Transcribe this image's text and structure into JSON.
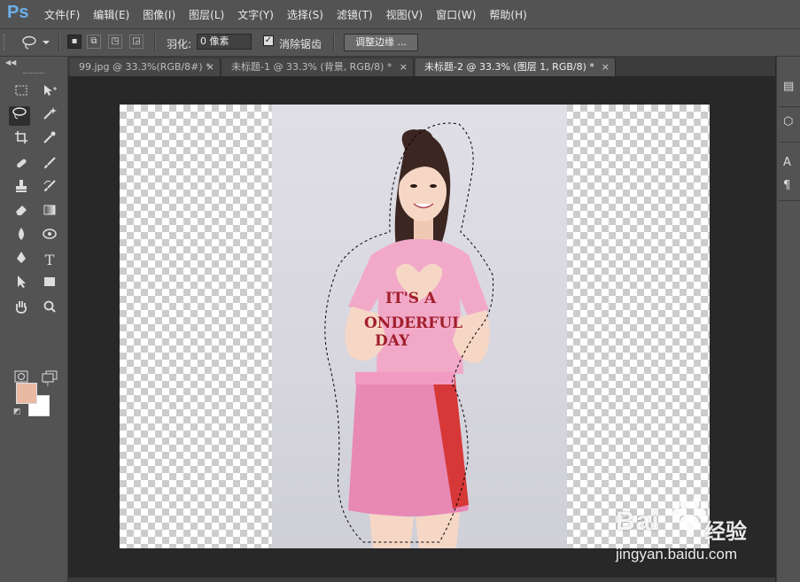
{
  "app": {
    "logo": "Ps",
    "menu": [
      "文件(F)",
      "编辑(E)",
      "图像(I)",
      "图层(L)",
      "文字(Y)",
      "选择(S)",
      "滤镜(T)",
      "视图(V)",
      "窗口(W)",
      "帮助(H)"
    ]
  },
  "options": {
    "tool_icon": "lasso-icon",
    "feather_label": "羽化:",
    "feather_value": "0 像素",
    "antialias_label": "消除锯齿",
    "antialias_checked": true,
    "refine_button": "调整边缘 ..."
  },
  "tabs": [
    {
      "label": "99.jpg @ 33.3%(RGB/8#) *",
      "close": "×",
      "active": false
    },
    {
      "label": "未标题-1 @ 33.3% (背景, RGB/8) *",
      "close": "×",
      "active": false
    },
    {
      "label": "未标题-2 @ 33.3% (图层 1, RGB/8) *",
      "close": "×",
      "active": true
    }
  ],
  "colors": {
    "foreground": "#e9b9a4",
    "background": "#ffffff",
    "ui_panel": "#535353",
    "workspace": "#282828"
  },
  "tools": [
    "rect-marquee-icon",
    "move-icon",
    "lasso-icon",
    "magic-wand-icon",
    "crop-icon",
    "eyedropper-icon",
    "healing-brush-icon",
    "brush-icon",
    "clone-stamp-icon",
    "history-brush-icon",
    "eraser-icon",
    "gradient-icon",
    "blur-icon",
    "dodge-icon",
    "pen-icon",
    "type-icon",
    "path-select-icon",
    "rectangle-shape-icon",
    "hand-icon",
    "zoom-icon",
    "quick-mask-icon",
    "screen-mode-icon"
  ],
  "canvas": {
    "shirt_text": [
      "IT'S A",
      "ONDERFUL",
      "DAY"
    ]
  },
  "watermark": {
    "brand": "Bai",
    "cn": "经验",
    "url": "jingyan.baidu.com"
  }
}
